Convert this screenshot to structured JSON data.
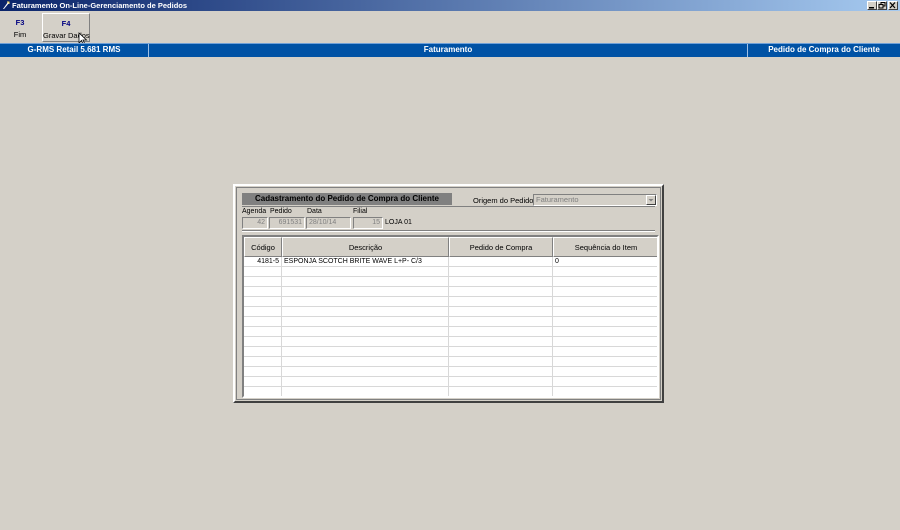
{
  "window": {
    "title": "Faturamento On-Line-Gerenciamento de Pedidos",
    "controls": [
      "minimize-icon",
      "restore-icon",
      "close-icon"
    ]
  },
  "toolbar": {
    "buttons": [
      {
        "key": "F3",
        "label": "Fim"
      },
      {
        "key": "F4",
        "label": "Gravar Dados"
      }
    ]
  },
  "header": {
    "left": "G-RMS Retail 5.681 RMS",
    "center": "Faturamento",
    "right": "Pedido de Compra do Cliente"
  },
  "form": {
    "caption": "Cadastramento do Pedido de Compra do Cliente",
    "origem_label": "Origem do Pedido:",
    "origem_value": "Faturamento",
    "labels": {
      "agenda": "Agenda",
      "pedido": "Pedido",
      "data": "Data",
      "filial": "Filial"
    },
    "values": {
      "agenda": "42",
      "pedido": "691531",
      "data": "28/10/14",
      "filial": "15",
      "filial_nome": "LOJA 01"
    }
  },
  "grid": {
    "columns": [
      "Código",
      "Descrição",
      "Pedido de Compra",
      "Sequência do Item"
    ],
    "rows": [
      {
        "codigo": "4181-5",
        "descricao": "ESPONJA SCOTCH BRITE WAVE L+P- C/3",
        "pedido_compra": "",
        "sequencia": "0"
      }
    ]
  },
  "colors": {
    "header_bar": "#0052a5",
    "title_bar_start": "#0a246a",
    "title_bar_end": "#a6caf0",
    "face": "#d4d0c8"
  }
}
